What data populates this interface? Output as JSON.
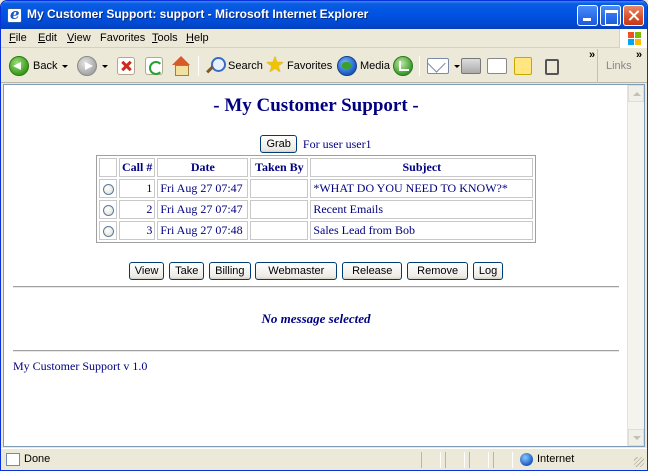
{
  "window": {
    "title": "My Customer Support: support - Microsoft Internet Explorer"
  },
  "menu": {
    "items": [
      {
        "key": "F",
        "rest": "ile"
      },
      {
        "key": "E",
        "rest": "dit"
      },
      {
        "key": "V",
        "rest": "iew"
      },
      {
        "key": "Fa",
        "rest": "vorites"
      },
      {
        "key": "T",
        "rest": "ools"
      },
      {
        "key": "H",
        "rest": "elp"
      }
    ]
  },
  "toolbar": {
    "back_label": "Back",
    "search_label": "Search",
    "favorites_label": "Favorites",
    "media_label": "Media",
    "links_label": "Links"
  },
  "page": {
    "title": "- My Customer Support -",
    "grab_button": "Grab",
    "for_user": "For user user1",
    "table": {
      "headers": [
        "",
        "Call #",
        "Date",
        "Taken By",
        "Subject"
      ],
      "rows": [
        {
          "call": "1",
          "date": "Fri Aug 27 07:47",
          "taken_by": "",
          "subject": "*WHAT DO YOU NEED TO KNOW?*"
        },
        {
          "call": "2",
          "date": "Fri Aug 27 07:47",
          "taken_by": "",
          "subject": "Recent Emails"
        },
        {
          "call": "3",
          "date": "Fri Aug 27 07:48",
          "taken_by": "",
          "subject": "Sales Lead from Bob"
        }
      ]
    },
    "actions": [
      "View",
      "Take",
      "Billing",
      "Webmaster",
      "Release",
      "Remove",
      "Log"
    ],
    "no_message": "No message selected",
    "footer": "My Customer Support v 1.0"
  },
  "status": {
    "text": "Done",
    "zone": "Internet"
  }
}
